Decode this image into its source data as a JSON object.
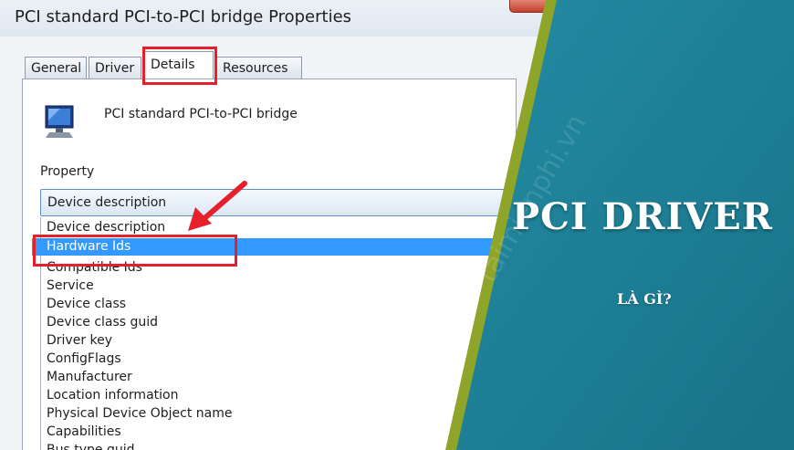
{
  "dialog": {
    "title": "PCI standard PCI-to-PCI bridge Properties",
    "tabs": [
      {
        "label": "General"
      },
      {
        "label": "Driver"
      },
      {
        "label": "Details"
      },
      {
        "label": "Resources"
      }
    ],
    "active_tab": "Details",
    "device_name": "PCI standard PCI-to-PCI bridge",
    "property_label": "Property",
    "property_select_value": "Device description",
    "property_options": [
      "Device description",
      "Hardware Ids",
      "Compatible Ids",
      "Service",
      "Device class",
      "Device class guid",
      "Driver key",
      "ConfigFlags",
      "Manufacturer",
      "Location information",
      "Physical Device Object name",
      "Capabilities",
      "Bus type guid"
    ],
    "selected_option": "Hardware Ids",
    "device_icon": "monitor-icon"
  },
  "banner": {
    "title": "PCI DRIVER",
    "subtitle": "LÀ GÌ?",
    "watermark": "taimienphi.vn",
    "colors": {
      "teal": "#1d7f96",
      "olive_stripe": "#8fa52a",
      "highlight_red": "#e5202a",
      "selection_blue": "#3399ff"
    }
  }
}
